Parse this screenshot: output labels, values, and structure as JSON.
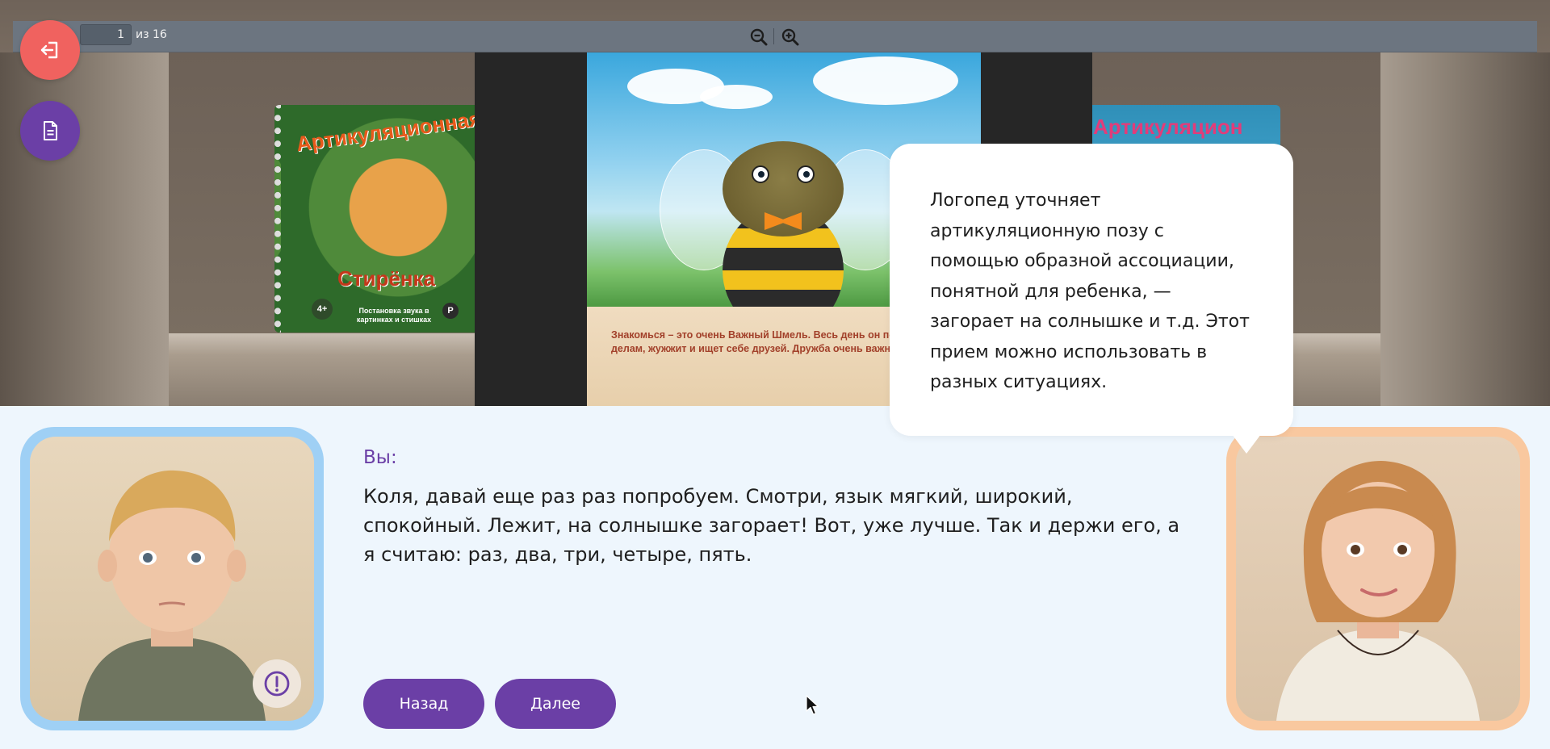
{
  "viewer": {
    "current_page": "1",
    "page_of": "из 16",
    "page_text": "Знакомься – это очень Важный Шмель. Весь день он по своим делам, жужжит и ищет себе друзей. Дружба очень важна для Шмеля!",
    "book_left_title": "Артикуляционная",
    "book_left_subtitle": "Стирёнка",
    "book_left_bottom": "Постановка звука в картинках и стишках",
    "book_left_age": "4+",
    "book_left_letter": "Р",
    "book_right_title": "Артикуляцион"
  },
  "icons": {
    "exit": "exit-icon",
    "document": "document-icon",
    "zoom_out": "zoom-out-icon",
    "zoom_in": "zoom-in-icon",
    "warning": "exclamation-icon",
    "cursor": "mouse-cursor-icon"
  },
  "colors": {
    "accent": "#6b3fa6",
    "exit_button": "#f0625f",
    "child_frame": "#9fd0f5",
    "teacher_frame": "#f9c89f",
    "background": "#eef6fd"
  },
  "dialog": {
    "speaker_label": "Вы:",
    "speech": "Коля, давай еще раз раз попробуем. Смотри, язык мягкий, широкий, спокойный. Лежит, на солнышке загорает! Вот, уже лучше. Так и держи его, а я считаю: раз, два, три, четыре, пять.",
    "back_label": "Назад",
    "next_label": "Далее"
  },
  "bubble": {
    "text": "Логопед уточняет артикуляционную позу с помощью образной ассоциации, понятной для ребенка, — загорает на солнышке и т.д. Этот прием можно использовать в разных ситуациях."
  }
}
